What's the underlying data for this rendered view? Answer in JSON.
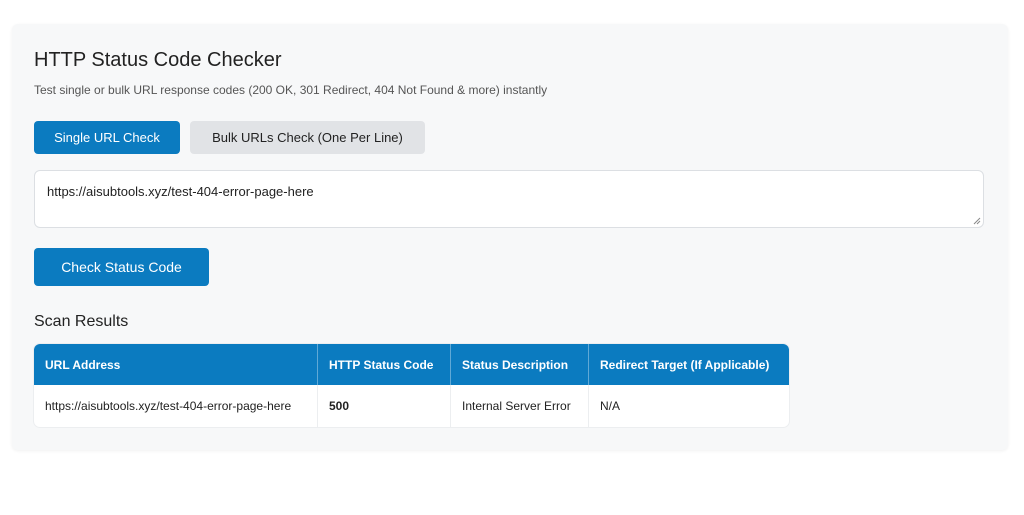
{
  "header": {
    "title": "HTTP Status Code Checker",
    "subtitle": "Test single or bulk URL response codes (200 OK, 301 Redirect, 404 Not Found & more) instantly"
  },
  "tabs": [
    {
      "label": "Single URL Check",
      "active": true
    },
    {
      "label": "Bulk URLs Check (One Per Line)",
      "active": false
    }
  ],
  "url_input": {
    "value": "https://aisubtools.xyz/test-404-error-page-here"
  },
  "check_button": {
    "label": "Check Status Code"
  },
  "results": {
    "title": "Scan Results",
    "columns": [
      "URL Address",
      "HTTP Status Code",
      "Status Description",
      "Redirect Target (If Applicable)"
    ],
    "rows": [
      {
        "url": "https://aisubtools.xyz/test-404-error-page-here",
        "code": "500",
        "description": "Internal Server Error",
        "redirect": "N/A"
      }
    ]
  },
  "colors": {
    "accent": "#0b7bc0",
    "status_500": "#e88a1a"
  }
}
